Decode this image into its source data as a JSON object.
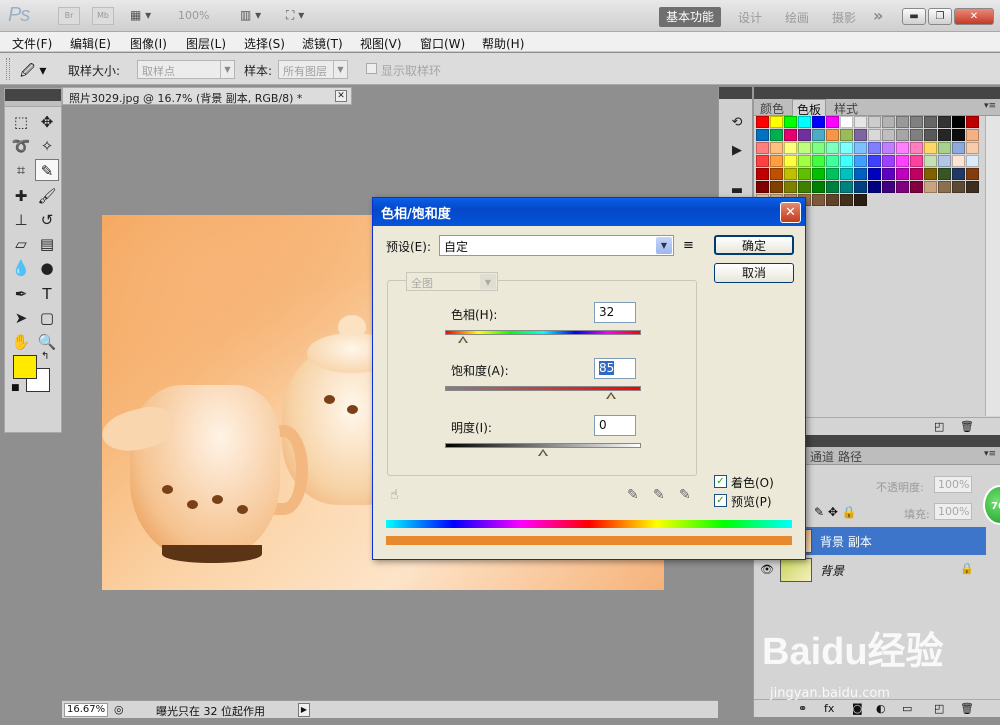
{
  "appbar": {
    "logo": "Ps",
    "bridge": "Br",
    "minibridge": "Mb",
    "zoom": "100%",
    "workspaces": {
      "active": "基本功能",
      "design": "设计",
      "painting": "绘画",
      "photography": "摄影"
    }
  },
  "menubar": [
    "文件(F)",
    "编辑(E)",
    "图像(I)",
    "图层(L)",
    "选择(S)",
    "滤镜(T)",
    "视图(V)",
    "窗口(W)",
    "帮助(H)"
  ],
  "options": {
    "sample_size_label": "取样大小:",
    "sample_size_value": "取样点",
    "sample_label": "样本:",
    "sample_value": "所有图层",
    "show_ring_label": "显示取样环"
  },
  "document": {
    "tab_title": "照片3029.jpg @ 16.7% (背景 副本, RGB/8) *"
  },
  "status": {
    "zoom": "16.67%",
    "message": "曝光只在 32 位起作用"
  },
  "swatches_panel": {
    "tabs": [
      "颜色",
      "色板",
      "样式"
    ],
    "active_tab": "色板",
    "colors": [
      "#ff0000",
      "#ffff00",
      "#00ff00",
      "#00ffff",
      "#0000ff",
      "#ff00ff",
      "#ffffff",
      "#e6e6e6",
      "#cccccc",
      "#b3b3b3",
      "#999999",
      "#808080",
      "#666666",
      "#333333",
      "#000000",
      "#c00000",
      "#0070c0",
      "#00b050",
      "#e5006e",
      "#7030a0",
      "#4bacc6",
      "#f79646",
      "#9bbb59",
      "#8064a2",
      "#d9d9d9",
      "#bfbfbf",
      "#a6a6a6",
      "#7f7f7f",
      "#595959",
      "#262626",
      "#0d0d0d",
      "#f4b183",
      "#ff7f7f",
      "#ffbf7f",
      "#ffff7f",
      "#bfff7f",
      "#7fff7f",
      "#7fffbf",
      "#7fffff",
      "#7fbfff",
      "#7f7fff",
      "#bf7fff",
      "#ff7fff",
      "#ff7fbf",
      "#ffd966",
      "#a9d08e",
      "#8ea9db",
      "#f8cbad",
      "#ff4040",
      "#ff9f40",
      "#ffff40",
      "#9fff40",
      "#40ff40",
      "#40ff9f",
      "#40ffff",
      "#409fff",
      "#4040ff",
      "#9f40ff",
      "#ff40ff",
      "#ff409f",
      "#c6e0b4",
      "#b4c6e7",
      "#fce4d6",
      "#ddebf7",
      "#c00000",
      "#c05000",
      "#c0c000",
      "#60c000",
      "#00c000",
      "#00c060",
      "#00c0c0",
      "#0060c0",
      "#0000c0",
      "#6000c0",
      "#c000c0",
      "#c00060",
      "#806000",
      "#375623",
      "#1f3864",
      "#833c0b",
      "#800000",
      "#804000",
      "#808000",
      "#408000",
      "#008000",
      "#008040",
      "#008080",
      "#004080",
      "#000080",
      "#400080",
      "#800080",
      "#800040",
      "#c9a47e",
      "#8b6f4e",
      "#5c4a35",
      "#3d2f20",
      "#e3c9a6",
      "#d6b28a",
      "#b8926a",
      "#9a7550",
      "#7d5a3a",
      "#604228",
      "#43301d",
      "#2a1e12"
    ]
  },
  "layers_panel": {
    "tabs": [
      "通道",
      "路径"
    ],
    "opacity_label": "不透明度:",
    "opacity_value": "100%",
    "fill_label": "填充:",
    "fill_value": "100%",
    "badge": "76",
    "layers": [
      {
        "name": "背景 副本",
        "selected": true,
        "locked": false
      },
      {
        "name": "背景",
        "selected": false,
        "locked": true
      }
    ]
  },
  "dialog": {
    "title": "色相/饱和度",
    "preset_label": "预设(E):",
    "preset_value": "自定",
    "channel_value": "全图",
    "ok_label": "确定",
    "cancel_label": "取消",
    "hue_label": "色相(H):",
    "hue_value": "32",
    "saturation_label": "饱和度(A):",
    "saturation_value": "85",
    "lightness_label": "明度(I):",
    "lightness_value": "0",
    "colorize_label": "着色(O)",
    "colorize_checked": true,
    "preview_label": "预览(P)",
    "preview_checked": true,
    "result_color": "#e78a2f"
  },
  "watermark": {
    "text": "Baidu经验",
    "url": "jingyan.baidu.com"
  }
}
